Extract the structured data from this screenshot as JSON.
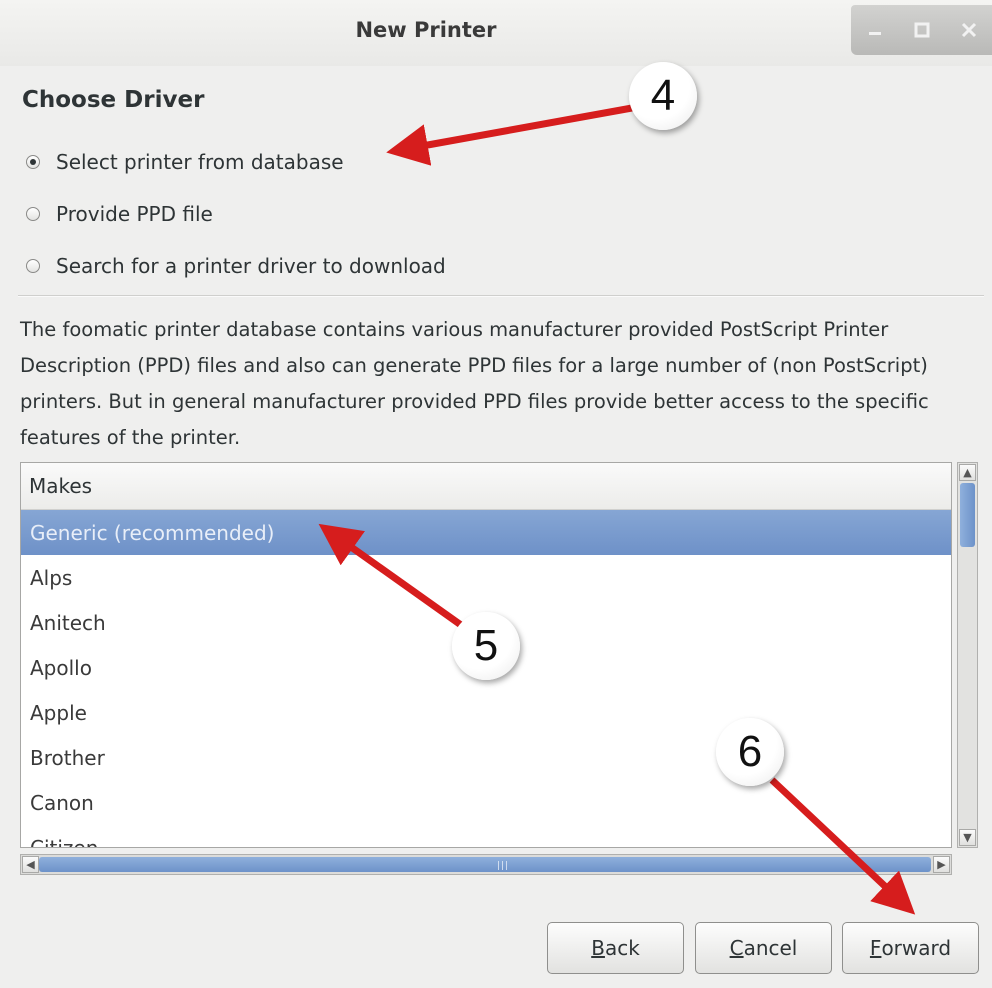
{
  "window": {
    "title": "New Printer"
  },
  "section": {
    "heading": "Choose Driver"
  },
  "options": [
    {
      "label": "Select printer from database",
      "checked": true
    },
    {
      "label": "Provide PPD file",
      "checked": false
    },
    {
      "label": "Search for a printer driver to download",
      "checked": false
    }
  ],
  "description": "The foomatic printer database contains various manufacturer provided PostScript Printer Description (PPD) files and also can generate PPD files for a large number of (non PostScript) printers. But in general manufacturer provided PPD files provide better access to the specific features of the printer.",
  "makes_list": {
    "header": "Makes",
    "items": [
      "Generic (recommended)",
      "Alps",
      "Anitech",
      "Apollo",
      "Apple",
      "Brother",
      "Canon",
      "Citizen"
    ],
    "selected_index": 0
  },
  "buttons": {
    "back": {
      "mnemonic": "B",
      "rest": "ack"
    },
    "cancel": {
      "mnemonic": "C",
      "rest": "ancel"
    },
    "forward": {
      "mnemonic": "F",
      "rest": "orward"
    }
  },
  "callouts": [
    "4",
    "5",
    "6"
  ],
  "colors": {
    "accent_arrow": "#d61d1d",
    "selection": "#7396cc"
  },
  "icons": {
    "minimize": "minimize-icon",
    "maximize": "maximize-icon",
    "close": "close-icon"
  }
}
